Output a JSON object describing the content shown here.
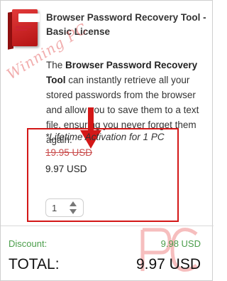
{
  "product": {
    "title": "Browser Password Recovery Tool - Basic License",
    "image_icon": "software-box-icon",
    "description_bold": "Browser Password Recovery Tool",
    "description_prefix": "The ",
    "description_rest": " can instantly retrieve all your stored passwords from the browser and allow you to save them to a text file, ensuring you never forget them again."
  },
  "license": {
    "activation": "*Lifetime Activation for 1 PC",
    "old_price": "19.95 USD",
    "new_price": "9.97 USD",
    "quantity": "1"
  },
  "summary": {
    "discount_label": "Discount:",
    "discount_value": "9.98 USD",
    "total_label": "TOTAL:",
    "total_value": "9.97 USD"
  },
  "colors": {
    "accent_red": "#d31717",
    "discount_green": "#4a9d4a",
    "strike_price": "#c94b4b"
  }
}
